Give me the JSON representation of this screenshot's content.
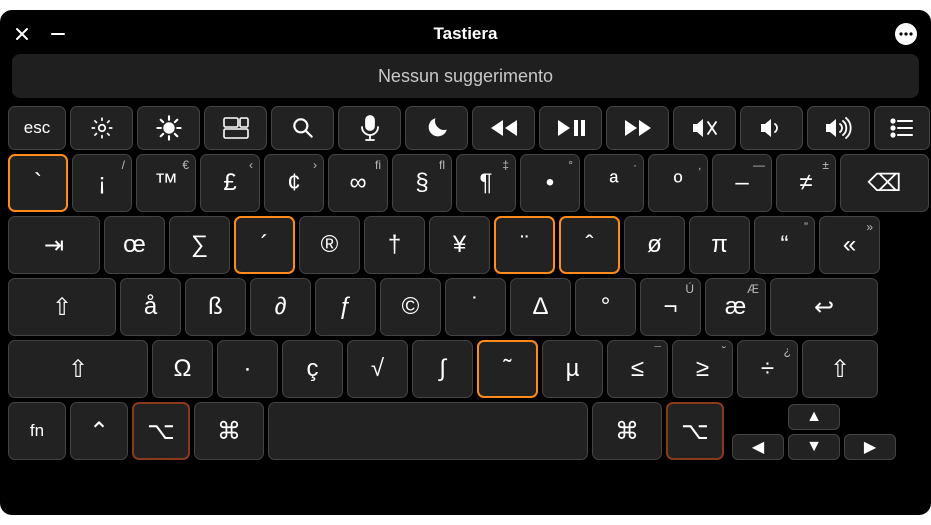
{
  "window": {
    "title": "Tastiera",
    "suggestion_text": "Nessun suggerimento"
  },
  "titlebar": {
    "close": "close",
    "minimize": "minimize",
    "more": "more"
  },
  "fn_row": {
    "esc": "esc",
    "icons": [
      "brightness-down",
      "brightness-up",
      "mission-control",
      "search",
      "dictation",
      "do-not-disturb",
      "rewind",
      "play-pause",
      "fast-forward",
      "mute",
      "volume-down",
      "volume-up",
      "list"
    ]
  },
  "row1": [
    {
      "main": "`",
      "sec": "",
      "hl": "orange"
    },
    {
      "main": "¡",
      "sec": "/"
    },
    {
      "main": "™",
      "sec": "€"
    },
    {
      "main": "£",
      "sec": "‹"
    },
    {
      "main": "¢",
      "sec": "›"
    },
    {
      "main": "∞",
      "sec": "fi"
    },
    {
      "main": "§",
      "sec": "fl"
    },
    {
      "main": "¶",
      "sec": "‡"
    },
    {
      "main": "•",
      "sec": "°"
    },
    {
      "main": "ª",
      "sec": "·"
    },
    {
      "main": "º",
      "sec": "‚"
    },
    {
      "main": "–",
      "sec": "—"
    },
    {
      "main": "≠",
      "sec": "±"
    },
    {
      "main": "⌫",
      "sec": ""
    }
  ],
  "row2": [
    {
      "main": "⇥",
      "sec": ""
    },
    {
      "main": "œ",
      "sec": ""
    },
    {
      "main": "∑",
      "sec": ""
    },
    {
      "main": "´",
      "sec": "",
      "hl": "orange"
    },
    {
      "main": "®",
      "sec": ""
    },
    {
      "main": "†",
      "sec": ""
    },
    {
      "main": "¥",
      "sec": ""
    },
    {
      "main": "¨",
      "sec": "",
      "hl": "orange"
    },
    {
      "main": "ˆ",
      "sec": "",
      "hl": "orange"
    },
    {
      "main": "ø",
      "sec": ""
    },
    {
      "main": "π",
      "sec": ""
    },
    {
      "main": "“",
      "sec": "”"
    },
    {
      "main": "«",
      "sec": "»"
    }
  ],
  "row3": [
    {
      "main": "⇧",
      "sec": ""
    },
    {
      "main": "å",
      "sec": ""
    },
    {
      "main": "ß",
      "sec": ""
    },
    {
      "main": "∂",
      "sec": ""
    },
    {
      "main": "ƒ",
      "sec": ""
    },
    {
      "main": "©",
      "sec": ""
    },
    {
      "main": "˙",
      "sec": ""
    },
    {
      "main": "Δ",
      "sec": ""
    },
    {
      "main": "°",
      "sec": ""
    },
    {
      "main": "¬",
      "sec": "Ú"
    },
    {
      "main": "æ",
      "sec": "Æ"
    },
    {
      "main": "↩",
      "sec": ""
    }
  ],
  "row4": [
    {
      "main": "⇧",
      "sec": ""
    },
    {
      "main": "Ω",
      "sec": ""
    },
    {
      "main": "∙",
      "sec": ""
    },
    {
      "main": "ç",
      "sec": ""
    },
    {
      "main": "√",
      "sec": ""
    },
    {
      "main": "∫",
      "sec": ""
    },
    {
      "main": "˜",
      "sec": "",
      "hl": "orange"
    },
    {
      "main": "µ",
      "sec": ""
    },
    {
      "main": "≤",
      "sec": "¯"
    },
    {
      "main": "≥",
      "sec": "˘"
    },
    {
      "main": "÷",
      "sec": "¿"
    },
    {
      "main": "⇧",
      "sec": ""
    }
  ],
  "row5": {
    "fn": "fn",
    "ctrl": "⌃",
    "opt_l": "⌥",
    "cmd_l": "⌘",
    "space": " ",
    "cmd_r": "⌘",
    "opt_r": "⌥",
    "arrows": {
      "up": "▲",
      "down": "▼",
      "left": "◀",
      "right": "▶"
    }
  }
}
